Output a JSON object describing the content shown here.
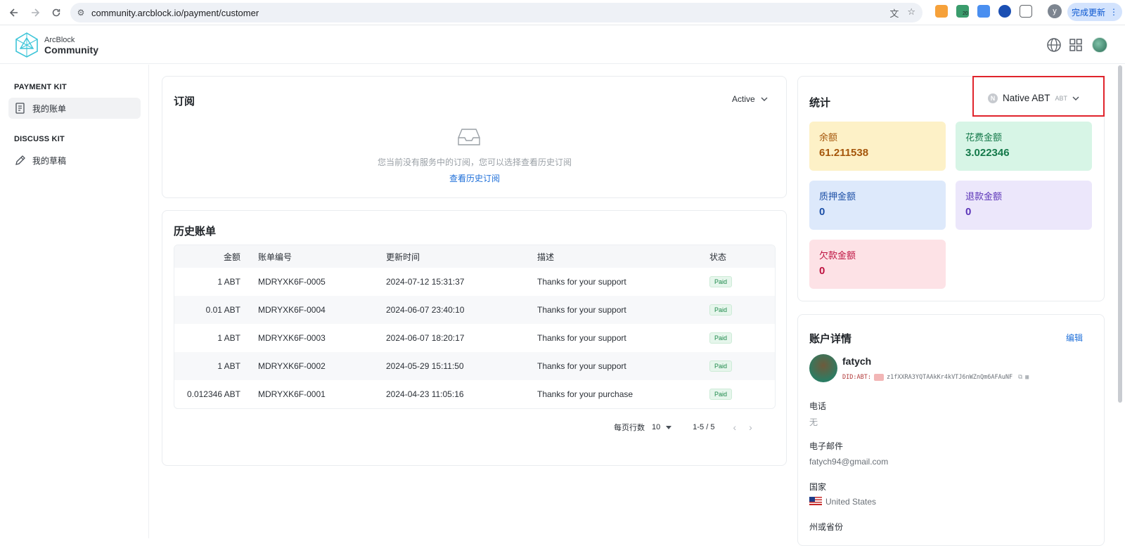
{
  "browser": {
    "url": "community.arcblock.io/payment/customer",
    "update_label": "完成更新",
    "profile_initial": "y",
    "extension_badge": "20"
  },
  "header": {
    "brand_top": "ArcBlock",
    "brand_main": "Community"
  },
  "sidebar": {
    "sections": [
      {
        "title": "PAYMENT KIT",
        "items": [
          {
            "label": "我的账单",
            "active": true
          }
        ]
      },
      {
        "title": "DISCUSS KIT",
        "items": [
          {
            "label": "我的草稿",
            "active": false
          }
        ]
      }
    ]
  },
  "subscriptions": {
    "title": "订阅",
    "filter": "Active",
    "empty_text": "您当前没有服务中的订阅，您可以选择查看历史订阅",
    "history_link": "查看历史订阅"
  },
  "invoices": {
    "title": "历史账单",
    "columns": [
      "金额",
      "账单编号",
      "更新时间",
      "描述",
      "状态"
    ],
    "rows": [
      {
        "amount": "1 ABT",
        "id": "MDRYXK6F-0005",
        "time": "2024-07-12 15:31:37",
        "desc": "Thanks for your support",
        "status": "Paid"
      },
      {
        "amount": "0.01 ABT",
        "id": "MDRYXK6F-0004",
        "time": "2024-06-07 23:40:10",
        "desc": "Thanks for your support",
        "status": "Paid"
      },
      {
        "amount": "1 ABT",
        "id": "MDRYXK6F-0003",
        "time": "2024-06-07 18:20:17",
        "desc": "Thanks for your support",
        "status": "Paid"
      },
      {
        "amount": "1 ABT",
        "id": "MDRYXK6F-0002",
        "time": "2024-05-29 15:11:50",
        "desc": "Thanks for your support",
        "status": "Paid"
      },
      {
        "amount": "0.012346 ABT",
        "id": "MDRYXK6F-0001",
        "time": "2024-04-23 11:05:16",
        "desc": "Thanks for your purchase",
        "status": "Paid"
      }
    ],
    "rows_per_page_label": "每页行数",
    "rows_per_page": "10",
    "range": "1-5 / 5"
  },
  "stats": {
    "title": "统计",
    "currency": {
      "name": "Native ABT",
      "symbol": "ABT",
      "coin_letter": "N"
    },
    "items": [
      {
        "label": "余额",
        "value": "61.211538",
        "bg": "#fdf1c7",
        "color": "#a5560b"
      },
      {
        "label": "花费金额",
        "value": "3.022346",
        "bg": "#d7f5e6",
        "color": "#14794a"
      },
      {
        "label": "质押金额",
        "value": "0",
        "bg": "#dde9fb",
        "color": "#1c4fa6"
      },
      {
        "label": "退款金额",
        "value": "0",
        "bg": "#ece7fb",
        "color": "#5b34b8"
      },
      {
        "label": "欠款金额",
        "value": "0",
        "bg": "#fde2e6",
        "color": "#be1240"
      }
    ]
  },
  "account": {
    "title": "账户详情",
    "edit": "编辑",
    "name": "fatych",
    "did_prefix": "DID:ABT:",
    "did": "z1fXXRA3YQTAAkKr4kVTJ6nWZnQm6AFAuNF",
    "fields": [
      {
        "label": "电话",
        "value": "无"
      },
      {
        "label": "电子邮件",
        "value": "fatych94@gmail.com"
      },
      {
        "label": "国家",
        "value": "United States"
      },
      {
        "label": "州或省份",
        "value": ""
      }
    ]
  }
}
